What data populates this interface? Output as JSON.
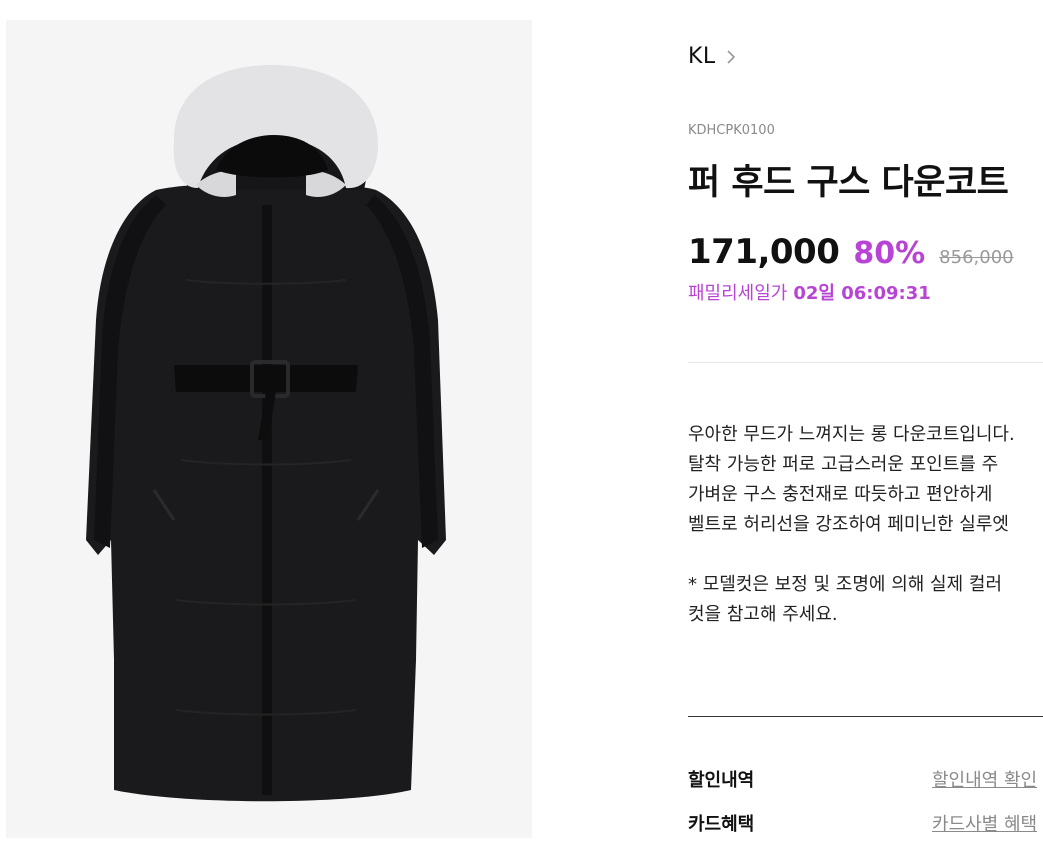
{
  "product_image": {
    "alt": "퍼 후드 구스 다운코트",
    "background": "#f5f5f5",
    "coat_color": "#1a1a1c",
    "fur_color": "#e3e3e5"
  },
  "brand": {
    "name": "KL",
    "icon": "chevron-right-icon"
  },
  "product": {
    "code": "KDHCPK0100",
    "title": "퍼 후드 구스 다운코트",
    "price": "171,000",
    "discount": "80%",
    "original_price": "856,000",
    "sale_label": "패밀리세일가",
    "sale_timer": "02일 06:09:31"
  },
  "description": {
    "lines": [
      "우아한 무드가 느껴지는 롱 다운코트입니다.",
      "탈착 가능한 퍼로 고급스러운 포인트를 주",
      "가벼운 구스 충전재로 따듯하고 편안하게",
      "벨트로 허리선을 강조하여 페미닌한 실루엣"
    ],
    "notes": [
      "* 모델컷은 보정 및 조명에 의해 실제 컬러",
      "컷을 참고해 주세요."
    ]
  },
  "benefits": [
    {
      "label": "할인내역",
      "link": "할인내역 확인"
    },
    {
      "label": "카드혜택",
      "link": "카드사별 혜택"
    }
  ],
  "colors": {
    "accent": "#b844d6",
    "muted": "#8a8a8a"
  }
}
